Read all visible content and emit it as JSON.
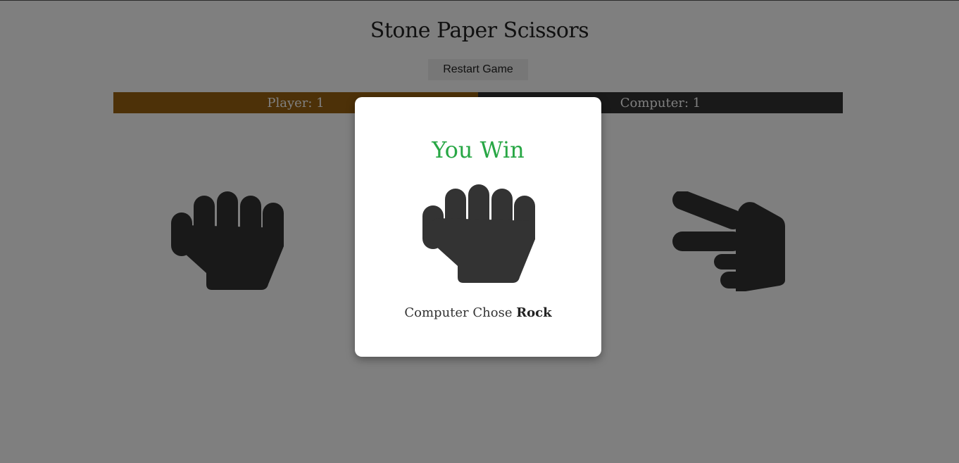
{
  "app": {
    "title": "Stone Paper Scissors",
    "restart_label": "Restart Game"
  },
  "scoreboard": {
    "player_label": "Player: 1",
    "computer_label": "Computer: 1",
    "player_color": "#9a6310",
    "computer_color": "#333333"
  },
  "choices": {
    "player_hand_icon": "rock-icon",
    "computer_hand_icon": "scissors-icon"
  },
  "modal": {
    "result": "You Win",
    "result_color": "#28a745",
    "hand_icon": "rock-icon",
    "chose_prefix": "Computer Chose",
    "chose_value": "Rock"
  }
}
